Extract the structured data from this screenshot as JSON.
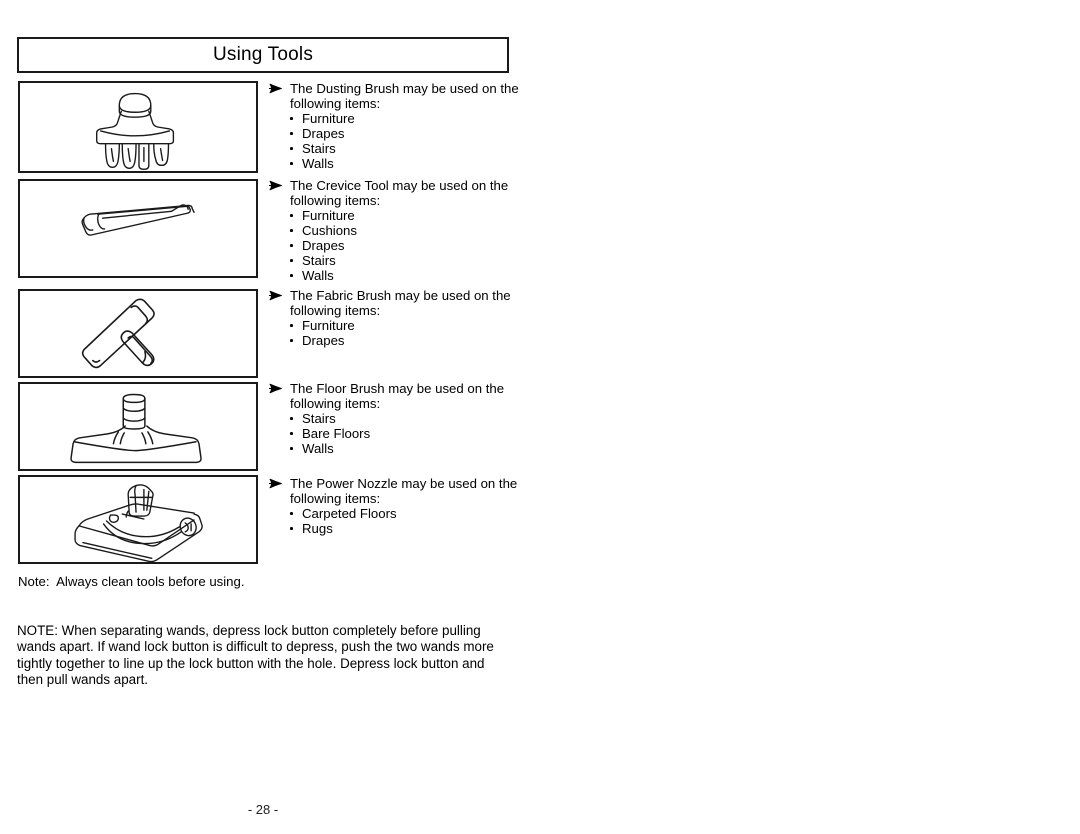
{
  "page": {
    "title": "Using Tools",
    "page_number": "- 28 -"
  },
  "tools": [
    {
      "id": "dusting-brush",
      "illustration": "dusting-brush-illustration",
      "heading": "The Dusting Brush may be used on the following items:",
      "items": [
        "Furniture",
        "Drapes",
        "Stairs",
        "Walls"
      ]
    },
    {
      "id": "crevice-tool",
      "illustration": "crevice-tool-illustration",
      "heading": "The Crevice Tool may be used on the following items:",
      "items": [
        "Furniture",
        "Cushions",
        "Drapes",
        "Stairs",
        "Walls"
      ]
    },
    {
      "id": "fabric-brush",
      "illustration": "fabric-brush-illustration",
      "heading": "The Fabric Brush may be used on the following items:",
      "items": [
        "Furniture",
        "Drapes"
      ]
    },
    {
      "id": "floor-brush",
      "illustration": "floor-brush-illustration",
      "heading": "The Floor Brush may be used on the following items:",
      "items": [
        "Stairs",
        "Bare Floors",
        "Walls"
      ]
    },
    {
      "id": "power-nozzle",
      "illustration": "power-nozzle-illustration",
      "heading": "The Power Nozzle may be used on the following items:",
      "items": [
        "Carpeted Floors",
        "Rugs"
      ]
    }
  ],
  "notes": {
    "clean_note": "Note:  Always clean tools before using.",
    "wand_note": "NOTE: When separating wands, depress lock button completely before pulling wands apart. If wand lock button is difficult to depress, push the two wands more tightly together to line up the lock button with the hole. Depress lock button and then pull wands apart."
  },
  "icons": {
    "bullet_arrow": "arrow-bullet-icon",
    "bullet_dot": "dot-bullet-icon"
  },
  "colors": {
    "ink": "#000000",
    "border": "#1a1a1a",
    "paper": "#ffffff"
  }
}
